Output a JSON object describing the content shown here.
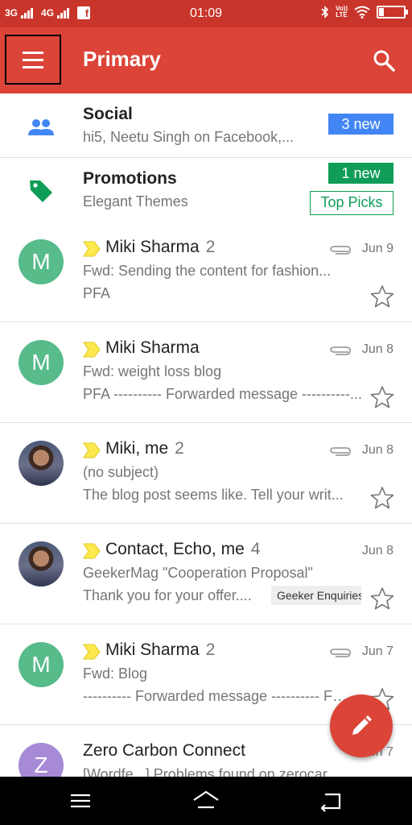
{
  "status_bar": {
    "network_1": "3G",
    "network_2": "4G",
    "time": "01:09",
    "volte_line1": "Vo))",
    "volte_line2": "LTE"
  },
  "app_bar": {
    "title": "Primary"
  },
  "categories": [
    {
      "name": "Social",
      "subtitle": "hi5, Neetu Singh on Facebook,...",
      "badge": "3 new",
      "icon": "people-icon",
      "color": "#4285f4"
    },
    {
      "name": "Promotions",
      "subtitle": "Elegant Themes",
      "badge": "1 new",
      "tag": "Top Picks",
      "icon": "tag-icon",
      "color": "#0f9d58"
    }
  ],
  "emails": [
    {
      "sender": "Miki Sharma",
      "count": "2",
      "date": "Jun 9",
      "subject": "Fwd: Sending the content for fashion...",
      "snippet": "PFA",
      "avatar": "M",
      "has_attachment": true,
      "important": true
    },
    {
      "sender": "Miki Sharma",
      "count": "",
      "date": "Jun 8",
      "subject": "Fwd: weight loss blog",
      "snippet": "PFA ---------- Forwarded message ----------...",
      "avatar": "M",
      "has_attachment": true,
      "important": true
    },
    {
      "sender": "Miki, me",
      "count": "2",
      "date": "Jun 8",
      "subject": "(no subject)",
      "snippet": "The blog post seems like. Tell your writ...",
      "avatar": "photo",
      "has_attachment": true,
      "important": true
    },
    {
      "sender": "Contact, Echo, me",
      "count": "4",
      "date": "Jun 8",
      "subject": "GeekerMag \"Cooperation Proposal\"",
      "snippet": "Thank you for your offer....",
      "label": "Geeker Enquiries",
      "avatar": "photo",
      "has_attachment": false,
      "important": true
    },
    {
      "sender": "Miki Sharma",
      "count": "2",
      "date": "Jun 7",
      "subject": "Fwd: Blog",
      "snippet": "---------- Forwarded message ---------- From:",
      "avatar": "M",
      "has_attachment": true,
      "important": true
    },
    {
      "sender": "Zero Carbon Connect",
      "count": "",
      "date": "Jun 7",
      "subject": "[Wordfe...] Problems found on zerocar...",
      "avatar": "Z",
      "has_attachment": false,
      "important": false
    }
  ],
  "colors": {
    "status_bar": "#c9352a",
    "app_bar": "#db4437",
    "important_marker": "#fce94f",
    "avatar_green": "#57bb8a",
    "avatar_purple": "#a78ad6"
  }
}
